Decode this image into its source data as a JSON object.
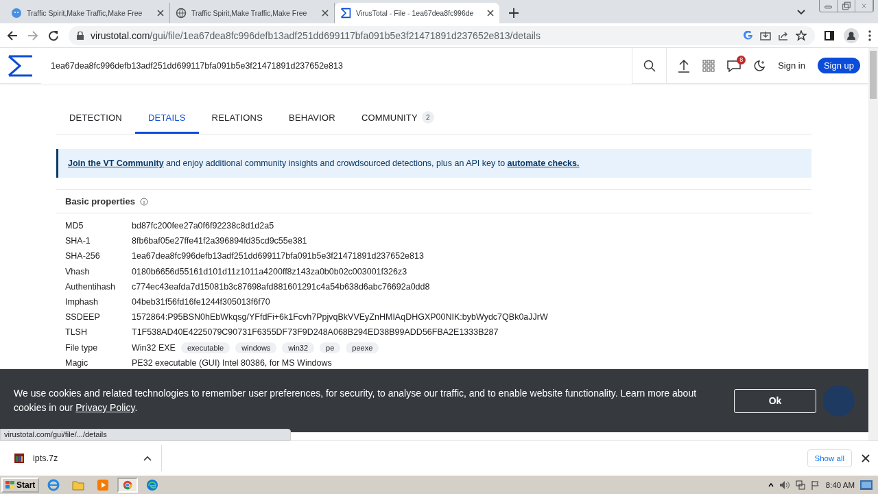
{
  "browser": {
    "tabs": [
      {
        "title": "Traffic Spirit,Make Traffic,Make Free",
        "selected": false
      },
      {
        "title": "Traffic Spirit,Make Traffic,Make Free",
        "selected": false
      },
      {
        "title": "VirusTotal - File - 1ea67dea8fc996de",
        "selected": true
      }
    ],
    "url_host": "virustotal.com",
    "url_path": "/gui/file/1ea67dea8fc996defb13adf251dd699117bfa091b5e3f21471891d237652e813/details"
  },
  "header": {
    "search_value": "1ea67dea8fc996defb13adf251dd699117bfa091b5e3f21471891d237652e813",
    "notification_count": "8",
    "sign_in": "Sign in",
    "sign_up": "Sign up"
  },
  "nav_tabs": [
    {
      "label": "DETECTION",
      "selected": false
    },
    {
      "label": "DETAILS",
      "selected": true
    },
    {
      "label": "RELATIONS",
      "selected": false
    },
    {
      "label": "BEHAVIOR",
      "selected": false
    },
    {
      "label": "COMMUNITY",
      "selected": false,
      "count": "2"
    }
  ],
  "notice": [
    {
      "kind": "link",
      "text": "Join the VT Community"
    },
    {
      "kind": "text",
      "text": " and enjoy additional community insights and crowdsourced detections, plus an API key to "
    },
    {
      "kind": "link",
      "text": "automate checks."
    }
  ],
  "basic_properties": {
    "title": "Basic properties",
    "rows": [
      {
        "label": "MD5",
        "values": [
          "bd87fc200fee27a0f6f92238c8d1d2a5"
        ]
      },
      {
        "label": "SHA-1",
        "values": [
          "8fb6baf05e27ffe41f2a396894fd35cd9c55e381"
        ]
      },
      {
        "label": "SHA-256",
        "values": [
          "1ea67dea8fc996defb13adf251dd699117bfa091b5e3f21471891d237652e813"
        ]
      },
      {
        "label": "Vhash",
        "values": [
          "0180b6656d55161d101d11z1011a4200ff8z143za0b0b02c003001f326z3"
        ]
      },
      {
        "label": "Authentihash",
        "values": [
          "c774ec43eafda7d15081b3c87698afd881601291c4a54b638d6abc76692a0dd8"
        ]
      },
      {
        "label": "Imphash",
        "values": [
          "04beb31f56fd16fe1244f305013f6f70"
        ]
      },
      {
        "label": "SSDEEP",
        "values": [
          "1572864:P95BSN0hEbWkqsg/YFfdFi+6k1Fcvh7PpjvqBkVVEyZnHMIAqDHGXP00NIK:bybWydc7QBk0aJJrW"
        ]
      },
      {
        "label": "TLSH",
        "values": [
          "T1F538AD40E4225079C90731F6355DF73F9D248A068B294ED38B99ADD56FBA2E1333B287"
        ]
      },
      {
        "label": "File type",
        "values": [
          "Win32 EXE"
        ],
        "tags": [
          "executable",
          "windows",
          "win32",
          "pe",
          "peexe"
        ]
      },
      {
        "label": "Magic",
        "values": [
          "PE32 executable (GUI) Intel 80386, for MS Windows"
        ]
      }
    ]
  },
  "cookie_banner": {
    "text": "We use cookies and related technologies to remember user preferences, for security, to analyse our traffic, and to enable website functionality. Learn more about cookies in our ",
    "link": "Privacy Policy",
    "after": ".",
    "button": "Ok"
  },
  "status_url": "virustotal.com/gui/file/.../details",
  "downloads": {
    "file": "ipts.7z",
    "show_all": "Show all"
  },
  "taskbar": {
    "start": "Start",
    "apps": [
      {
        "selected": false
      },
      {
        "selected": false
      },
      {
        "selected": false
      },
      {
        "selected": true
      },
      {
        "selected": false
      }
    ],
    "clock": "8:40 AM"
  }
}
